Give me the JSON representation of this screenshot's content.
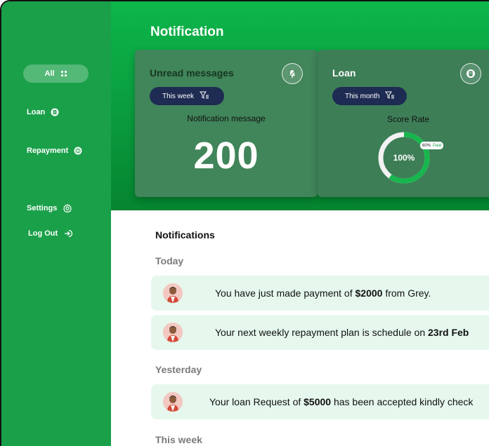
{
  "page": {
    "title": "Notification"
  },
  "sidebar": {
    "items": [
      {
        "label": "All",
        "icon": "grid-icon"
      },
      {
        "label": "Loan",
        "icon": "loan-icon"
      },
      {
        "label": "Repayment",
        "icon": "repayment-icon"
      },
      {
        "label": "Settings",
        "icon": "gear-icon"
      },
      {
        "label": "Log Out",
        "icon": "logout-icon"
      }
    ]
  },
  "cards": {
    "unread": {
      "title": "Unread messages",
      "filter": "This week",
      "subtitle": "Notification message",
      "count": "200",
      "icon": "bell-icon"
    },
    "loan": {
      "title": "Loan",
      "filter": "This month",
      "subtitle": "Score Rate",
      "percent_label": "100%",
      "paid_percent": "60%",
      "paid_word": "Paid",
      "paid_fraction": 0.6,
      "icon": "document-icon"
    }
  },
  "notifications": {
    "title": "Notifications",
    "groups": {
      "today": "Today",
      "yesterday": "Yesterday",
      "this_week": "This week"
    },
    "items": [
      {
        "pre": "You have just made payment of ",
        "bold": "$2000",
        "post": " from Grey."
      },
      {
        "pre": "Your  next weekly repayment plan is schedule on ",
        "bold": "23rd Feb",
        "post": ""
      },
      {
        "pre": "Your loan Request of ",
        "bold": "$5000",
        "post": " has been accepted kindly check"
      }
    ]
  },
  "colors": {
    "brand_green": "#1ba04a",
    "header_green": "#0db64a",
    "card_green": "#41855a",
    "pill_navy": "#1e2b52",
    "notif_bg": "#e6f8ed"
  }
}
